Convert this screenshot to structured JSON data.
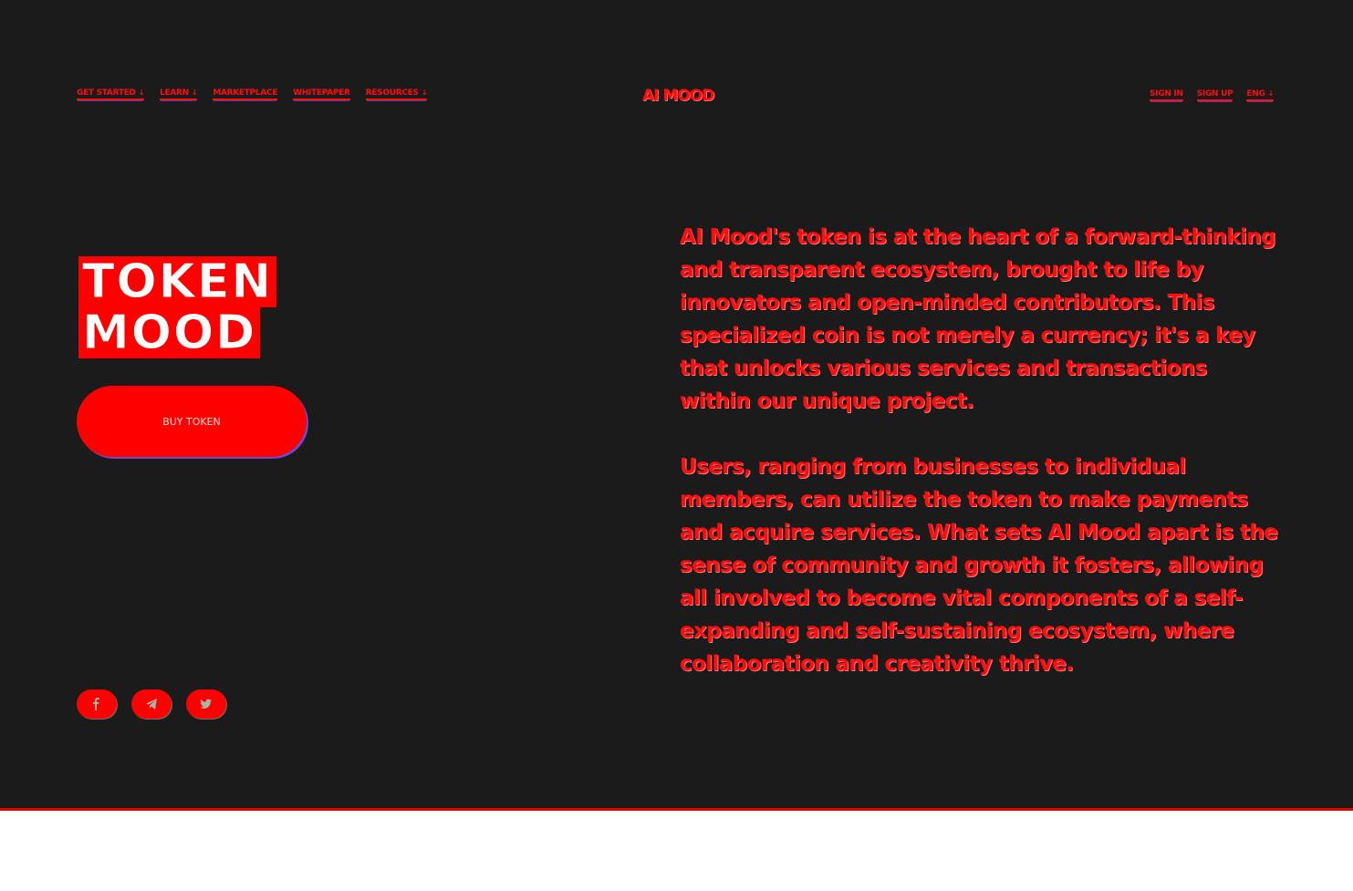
{
  "nav_left": [
    {
      "label": "GET STARTED",
      "caret": "↓"
    },
    {
      "label": "LEARN",
      "caret": "↓"
    },
    {
      "label": "MARKETPLACE",
      "caret": ""
    },
    {
      "label": "WHITEPAPER",
      "caret": ""
    },
    {
      "label": "RESOURCES",
      "caret": "↓"
    }
  ],
  "logo": "AI MOOD",
  "nav_right": [
    {
      "label": "SIGN IN",
      "caret": ""
    },
    {
      "label": "SIGN UP",
      "caret": ""
    },
    {
      "label": "ENG",
      "caret": "↓"
    }
  ],
  "hero": {
    "title_line1": "TOKEN",
    "title_line2": "MOOD",
    "cta_label": "BUY TOKEN"
  },
  "description": {
    "paragraph1": "AI Mood's token is at the heart of a forward-thinking and transparent ecosystem, brought to life by innovators and open-minded contributors. This specialized coin is not merely a currency; it's a key that unlocks various services and transactions within our unique project.",
    "paragraph2": "Users, ranging from businesses to individual members, can utilize the token to make payments and acquire services. What sets AI Mood apart is the sense of community and growth it fosters, allowing all involved to become vital components of a self-expanding and self-sustaining ecosystem, where collaboration and creativity thrive."
  },
  "socials": [
    {
      "icon": "facebook-icon"
    },
    {
      "icon": "telegram-icon"
    },
    {
      "icon": "twitter-icon"
    }
  ],
  "colors": {
    "background": "#1b1b1b",
    "accent": "#ff0000",
    "text": "#ff0d0d"
  }
}
